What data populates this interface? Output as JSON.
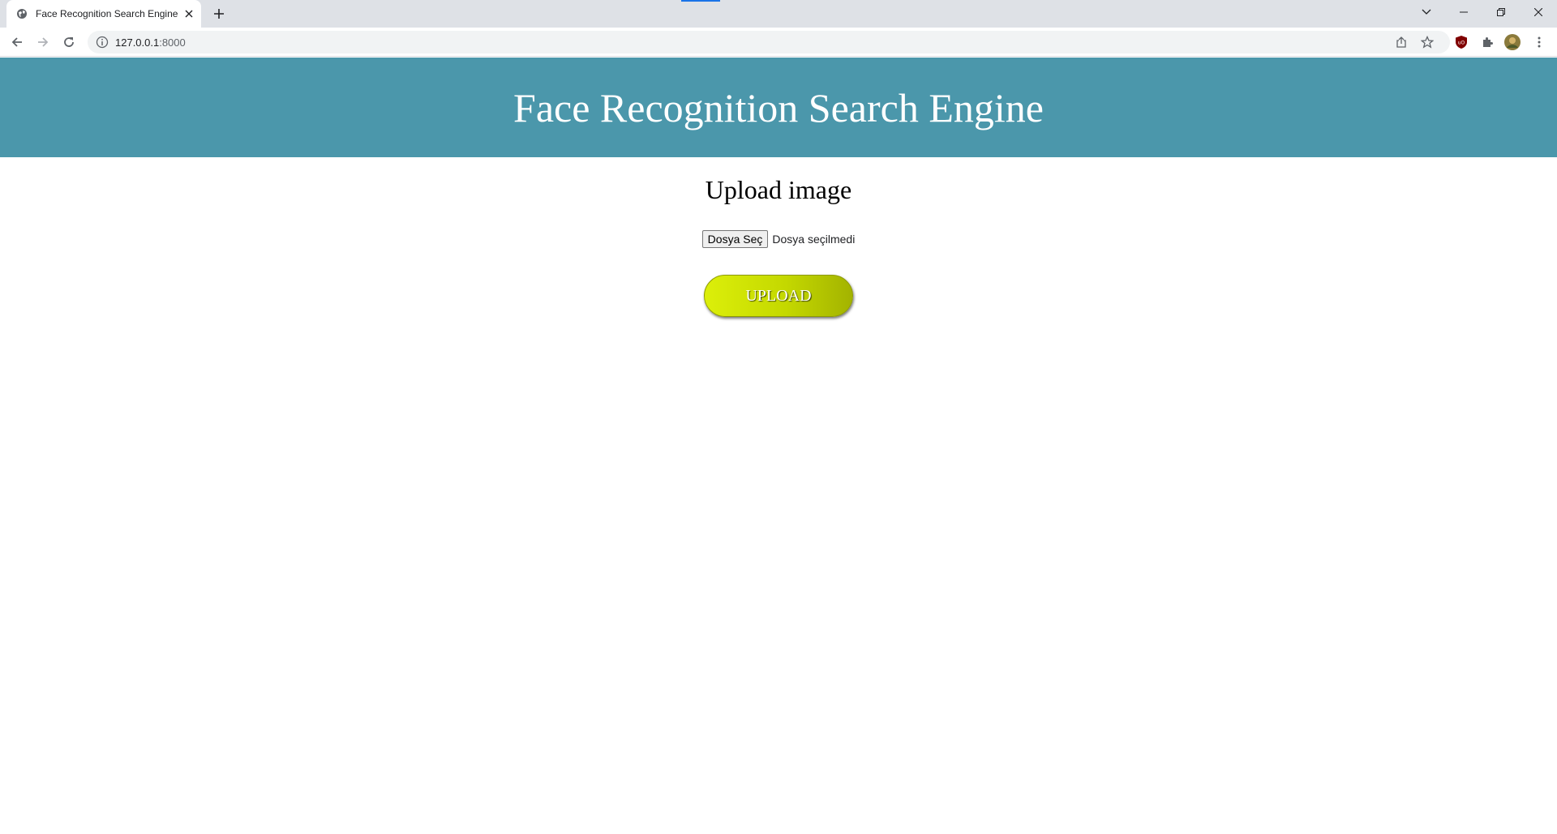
{
  "browser": {
    "tab": {
      "title": "Face Recognition Search Engine",
      "favicon": "globe-icon"
    },
    "address": {
      "host": "127.0.0.1",
      "port": ":8000"
    },
    "window_controls": [
      "minimize",
      "restore",
      "close"
    ]
  },
  "page": {
    "banner": {
      "title": "Face Recognition Search Engine",
      "background": "#4b97ab"
    },
    "upload_heading": "Upload image",
    "file_input": {
      "button_label": "Dosya Seç",
      "status": "Dosya seçilmedi"
    },
    "upload_button": {
      "label": "UPLOAD",
      "color": "#c4d800"
    }
  }
}
